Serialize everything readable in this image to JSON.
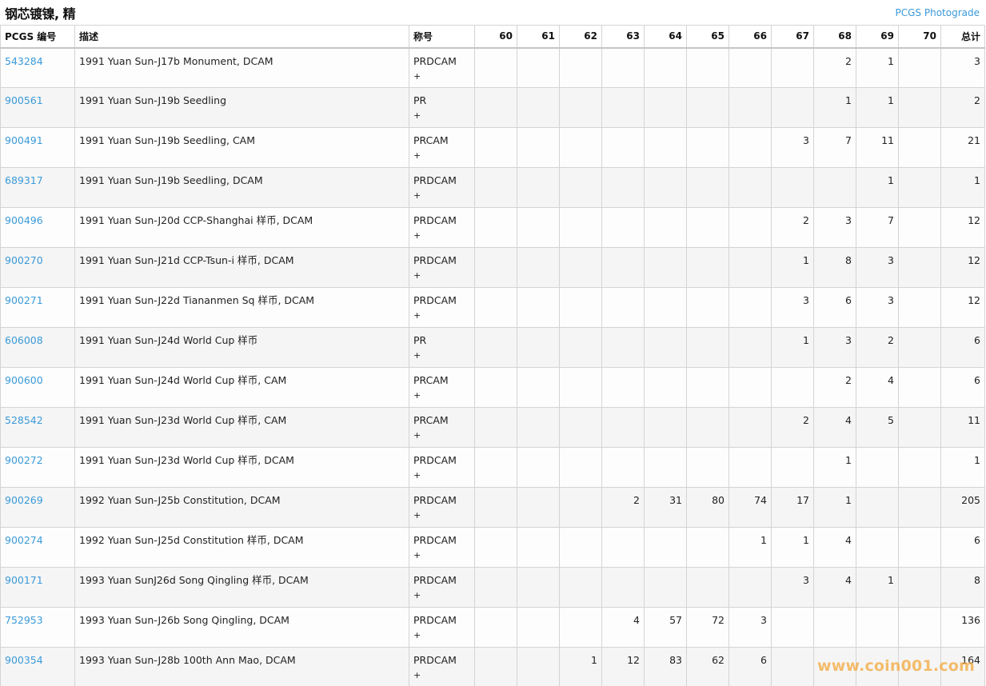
{
  "header": {
    "title": "钢芯镀镍, 精",
    "photograde_link": "PCGS Photograde"
  },
  "table": {
    "columns": {
      "code": "PCGS 编号",
      "description": "描述",
      "designation": "称号",
      "grades": [
        "60",
        "61",
        "62",
        "63",
        "64",
        "65",
        "66",
        "67",
        "68",
        "69",
        "70"
      ],
      "total": "总计"
    },
    "rows": [
      {
        "code": "543284",
        "description": "1991 Yuan Sun-J17b Monument, DCAM",
        "designation": "PRDCAM",
        "plus": "+",
        "grades": [
          "",
          "",
          "",
          "",
          "",
          "",
          "",
          "",
          "2",
          "1",
          ""
        ],
        "total": "3"
      },
      {
        "code": "900561",
        "description": "1991 Yuan Sun-J19b Seedling",
        "designation": "PR",
        "plus": "+",
        "grades": [
          "",
          "",
          "",
          "",
          "",
          "",
          "",
          "",
          "1",
          "1",
          ""
        ],
        "total": "2"
      },
      {
        "code": "900491",
        "description": "1991 Yuan Sun-J19b Seedling, CAM",
        "designation": "PRCAM",
        "plus": "+",
        "grades": [
          "",
          "",
          "",
          "",
          "",
          "",
          "",
          "3",
          "7",
          "11",
          ""
        ],
        "total": "21"
      },
      {
        "code": "689317",
        "description": "1991 Yuan Sun-J19b Seedling, DCAM",
        "designation": "PRDCAM",
        "plus": "+",
        "grades": [
          "",
          "",
          "",
          "",
          "",
          "",
          "",
          "",
          "",
          "1",
          ""
        ],
        "total": "1"
      },
      {
        "code": "900496",
        "description": "1991 Yuan Sun-J20d CCP-Shanghai 样币, DCAM",
        "designation": "PRDCAM",
        "plus": "+",
        "grades": [
          "",
          "",
          "",
          "",
          "",
          "",
          "",
          "2",
          "3",
          "7",
          ""
        ],
        "total": "12"
      },
      {
        "code": "900270",
        "description": "1991 Yuan Sun-J21d CCP-Tsun-i 样币, DCAM",
        "designation": "PRDCAM",
        "plus": "+",
        "grades": [
          "",
          "",
          "",
          "",
          "",
          "",
          "",
          "1",
          "8",
          "3",
          ""
        ],
        "total": "12"
      },
      {
        "code": "900271",
        "description": "1991 Yuan Sun-J22d Tiananmen Sq 样币, DCAM",
        "designation": "PRDCAM",
        "plus": "+",
        "grades": [
          "",
          "",
          "",
          "",
          "",
          "",
          "",
          "3",
          "6",
          "3",
          ""
        ],
        "total": "12"
      },
      {
        "code": "606008",
        "description": "1991 Yuan Sun-J24d World Cup 样币",
        "designation": "PR",
        "plus": "+",
        "grades": [
          "",
          "",
          "",
          "",
          "",
          "",
          "",
          "1",
          "3",
          "2",
          ""
        ],
        "total": "6"
      },
      {
        "code": "900600",
        "description": "1991 Yuan Sun-J24d World Cup 样币, CAM",
        "designation": "PRCAM",
        "plus": "+",
        "grades": [
          "",
          "",
          "",
          "",
          "",
          "",
          "",
          "",
          "2",
          "4",
          ""
        ],
        "total": "6"
      },
      {
        "code": "528542",
        "description": "1991 Yuan Sun-J23d World Cup 样币, CAM",
        "designation": "PRCAM",
        "plus": "+",
        "grades": [
          "",
          "",
          "",
          "",
          "",
          "",
          "",
          "2",
          "4",
          "5",
          ""
        ],
        "total": "11"
      },
      {
        "code": "900272",
        "description": "1991 Yuan Sun-J23d World Cup 样币, DCAM",
        "designation": "PRDCAM",
        "plus": "+",
        "grades": [
          "",
          "",
          "",
          "",
          "",
          "",
          "",
          "",
          "1",
          "",
          ""
        ],
        "total": "1"
      },
      {
        "code": "900269",
        "description": "1992 Yuan Sun-J25b Constitution, DCAM",
        "designation": "PRDCAM",
        "plus": "+",
        "grades": [
          "",
          "",
          "",
          "2",
          "31",
          "80",
          "74",
          "17",
          "1",
          "",
          ""
        ],
        "total": "205"
      },
      {
        "code": "900274",
        "description": "1992 Yuan Sun-J25d Constitution 样币, DCAM",
        "designation": "PRDCAM",
        "plus": "+",
        "grades": [
          "",
          "",
          "",
          "",
          "",
          "",
          "1",
          "1",
          "4",
          "",
          ""
        ],
        "total": "6"
      },
      {
        "code": "900171",
        "description": "1993 Yuan SunJ26d Song Qingling 样币, DCAM",
        "designation": "PRDCAM",
        "plus": "+",
        "grades": [
          "",
          "",
          "",
          "",
          "",
          "",
          "",
          "3",
          "4",
          "1",
          ""
        ],
        "total": "8"
      },
      {
        "code": "752953",
        "description": "1993 Yuan Sun-J26b Song Qingling, DCAM",
        "designation": "PRDCAM",
        "plus": "+",
        "grades": [
          "",
          "",
          "",
          "4",
          "57",
          "72",
          "3",
          "",
          "",
          "",
          ""
        ],
        "total": "136"
      },
      {
        "code": "900354",
        "description": "1993 Yuan Sun-J28b 100th Ann Mao, DCAM",
        "designation": "PRDCAM",
        "plus": "+",
        "grades": [
          "",
          "",
          "1",
          "12",
          "83",
          "62",
          "6",
          "",
          "",
          "",
          ""
        ],
        "total": "164"
      }
    ]
  },
  "watermark": "www.coin001.com",
  "colors": {
    "link": "#3a9ad9",
    "watermark": "#f3a83c",
    "row_alt": "#f5f5f5",
    "border": "#d4d4d4"
  }
}
